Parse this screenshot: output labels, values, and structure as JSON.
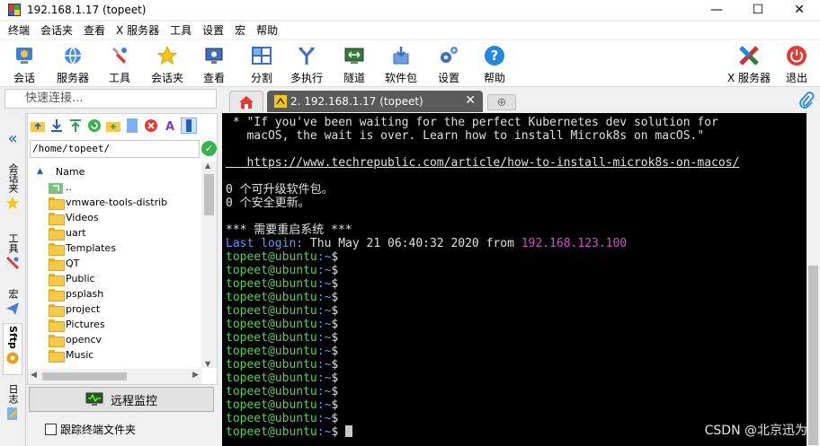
{
  "window": {
    "title": "192.168.1.17 (topeet)",
    "minimize": "—",
    "maximize": "☐",
    "close": "✕"
  },
  "menu": [
    "终端",
    "会话夹",
    "查看",
    "X 服务器",
    "工具",
    "设置",
    "宏",
    "帮助"
  ],
  "toolbar": {
    "session": "会话",
    "servers": "服务器",
    "tools": "工具",
    "sessions": "会话夹",
    "view": "查看",
    "split": "分割",
    "multiexec": "多执行",
    "tunnel": "隧道",
    "packages": "软件包",
    "settings": "设置",
    "help": "帮助",
    "xserver": "X 服务器",
    "exit": "退出"
  },
  "quick_connect": {
    "placeholder": "快速连接..."
  },
  "tabs": {
    "session_tab": "2. 192.168.1.17 (topeet)",
    "close": "✕",
    "new_tab": "⊕"
  },
  "sidebar": {
    "sessions": "会话夹",
    "tools": "工具",
    "macros": "宏",
    "sftp": "Sftp",
    "log": "日志"
  },
  "filebrowser": {
    "path": "/home/topeet/",
    "column_name": "Name",
    "items": [
      "..",
      "vmware-tools-distrib",
      "Videos",
      "uart",
      "Templates",
      "QT",
      "Public",
      "psplash",
      "project",
      "Pictures",
      "opencv",
      "Music"
    ]
  },
  "remote_monitor": "远程监控",
  "follow_terminal": "跟踪终端文件夹",
  "terminal": {
    "line1": " * \"If you've been waiting for the perfect Kubernetes dev solution for",
    "line2": "   macOS, the wait is over. Learn how to install Microk8s on macOS.\"",
    "line3": "   https://www.techrepublic.com/article/how-to-install-microk8s-on-macos/",
    "line4": "0 个可升级软件包。",
    "line5": "0 个安全更新。",
    "line6": "*** 需要重启系统 ***",
    "last_login_label": "Last login:",
    "last_login_value": " Thu May 21 06:40:32 2020 from ",
    "last_login_ip": "192.168.123.100",
    "prompt_user": "topeet@ubuntu",
    "prompt_path": ":~",
    "prompt_sign": "$",
    "prompt_count": 14
  },
  "watermark": "CSDN @北京迅为"
}
